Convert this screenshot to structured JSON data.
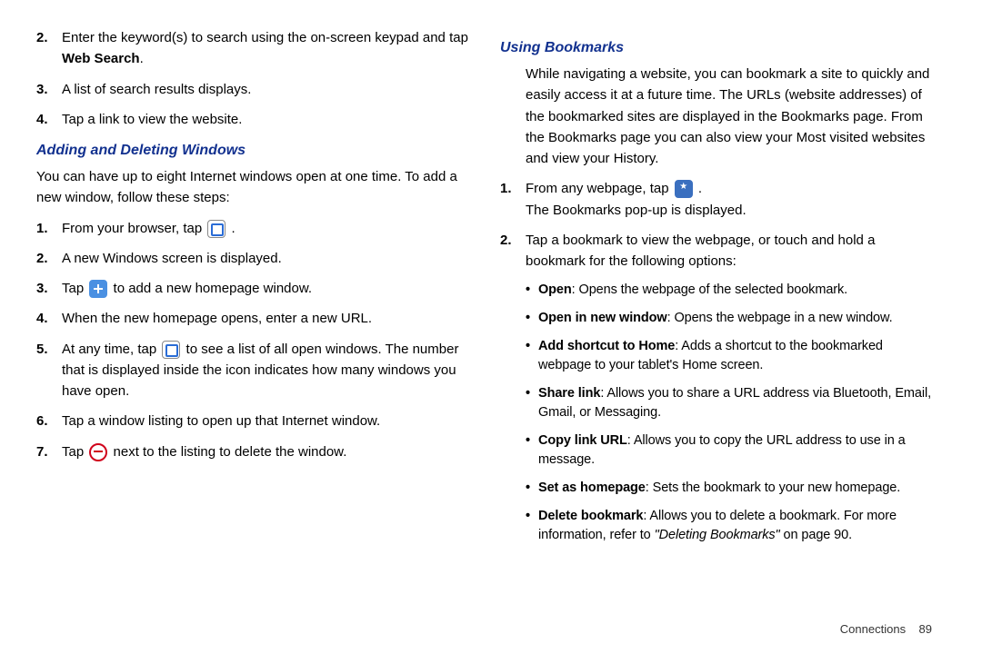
{
  "left": {
    "searchSteps": [
      {
        "num": "2.",
        "html": "Enter the keyword(s) to search using the on-screen keypad and tap <b>Web Search</b>."
      },
      {
        "num": "3.",
        "html": "A list of search results displays."
      },
      {
        "num": "4.",
        "html": "Tap a link to view the website."
      }
    ],
    "addingHeading": "Adding and Deleting Windows",
    "addingIntro": "You can have up to eight Internet windows open at one time. To add a new window, follow these steps:",
    "addingSteps": [
      {
        "num": "1.",
        "html": "From your browser, tap <span class='ic ic-windows' data-name='windows-icon' data-interactable='false'></span> ."
      },
      {
        "num": "2.",
        "html": "A new Windows screen is displayed."
      },
      {
        "num": "3.",
        "html": "Tap <span class='ic ic-plus' data-name='add-window-icon' data-interactable='false'></span> to add a new homepage window."
      },
      {
        "num": "4.",
        "html": " When the new homepage opens, enter a new URL."
      },
      {
        "num": "5.",
        "html": "At any time, tap <span class='ic ic-windows' data-name='windows-icon' data-interactable='false'></span> to see a list of all open windows. The number that is displayed inside the icon indicates how many windows you have open."
      },
      {
        "num": "6.",
        "html": "Tap a window listing to open up that Internet window."
      },
      {
        "num": "7.",
        "html": "Tap <span class='ic ic-remove' data-name='remove-icon' data-interactable='false'></span> next to the listing to delete the window."
      }
    ]
  },
  "right": {
    "bookmarksHeading": "Using Bookmarks",
    "bookmarksIntro": "While navigating a website, you can bookmark a site to quickly and easily access it at a future time. The URLs (website addresses) of the bookmarked sites are displayed in the Bookmarks page. From the Bookmarks page you can also view your Most visited websites and view your History.",
    "bookmarksSteps": [
      {
        "num": "1.",
        "html": "From any webpage, tap <span class='ic ic-bookmark' data-name='bookmark-icon' data-interactable='false'></span> .<br>The Bookmarks pop-up is displayed."
      },
      {
        "num": "2.",
        "html": "Tap a bookmark to view the webpage, or touch and hold a bookmark for the following options:"
      }
    ],
    "bookmarkOptions": [
      {
        "html": "<b>Open</b>: Opens the webpage of the selected bookmark."
      },
      {
        "html": "<b>Open in new window</b>: Opens the webpage in a new window."
      },
      {
        "html": "<b>Add shortcut to Home</b>: Adds a shortcut to the bookmarked webpage to your tablet's Home screen."
      },
      {
        "html": "<b>Share link</b>: Allows you to share a URL address via Bluetooth, Email, Gmail, or Messaging."
      },
      {
        "html": "<b>Copy link URL</b>: Allows you to copy the URL address to use in a message."
      },
      {
        "html": "<b>Set as homepage</b>: Sets the bookmark to your new homepage."
      },
      {
        "html": "<b>Delete bookmark</b>: Allows you to delete a bookmark. For more information, refer to <span class='ital-ref'>\"Deleting Bookmarks\"</span>  on page 90."
      }
    ]
  },
  "footer": {
    "section": "Connections",
    "page": "89"
  }
}
